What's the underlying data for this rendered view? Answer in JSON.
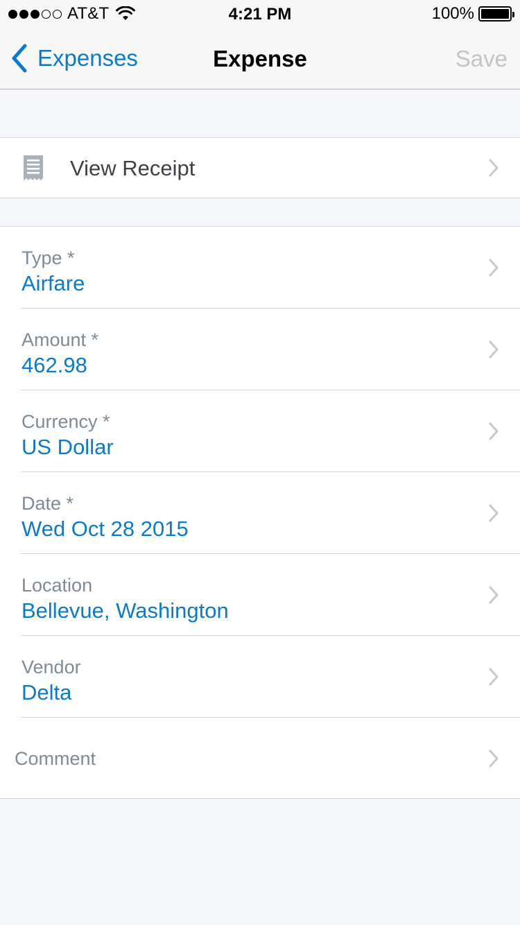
{
  "status_bar": {
    "carrier": "AT&T",
    "time": "4:21 PM",
    "battery": "100%",
    "signal_bars_filled": 3,
    "signal_bars_total": 5
  },
  "nav": {
    "back_label": "Expenses",
    "title": "Expense",
    "save_label": "Save"
  },
  "receipt": {
    "label": "View Receipt",
    "icon": "receipt-icon"
  },
  "fields": [
    {
      "label": "Type *",
      "value": "Airfare"
    },
    {
      "label": "Amount *",
      "value": "462.98"
    },
    {
      "label": "Currency *",
      "value": "US Dollar"
    },
    {
      "label": "Date *",
      "value": "Wed Oct 28 2015"
    },
    {
      "label": "Location",
      "value": "Bellevue, Washington"
    },
    {
      "label": "Vendor",
      "value": "Delta"
    }
  ],
  "comment": {
    "label": "Comment"
  },
  "colors": {
    "accent": "#0a7acc",
    "label_gray": "#7f8a94",
    "disabled": "#c4c4c4",
    "background": "#f4f6f9"
  }
}
